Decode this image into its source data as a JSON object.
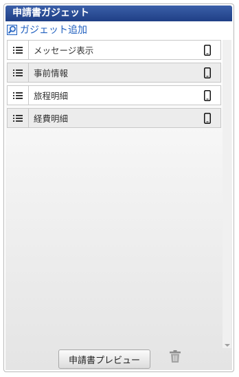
{
  "panel": {
    "title": "申請書ガジェット",
    "add_gadget_label": "ガジェット追加",
    "gadgets": [
      {
        "label": "メッセージ表示",
        "icon": "mobile-icon"
      },
      {
        "label": "事前情報",
        "icon": "mobile-icon"
      },
      {
        "label": "旅程明細",
        "icon": "mobile-icon"
      },
      {
        "label": "経費明細",
        "icon": "mobile-icon"
      }
    ],
    "preview_button_label": "申請書プレビュー"
  },
  "colors": {
    "header": "#2a4c95",
    "link": "#1f5fbf"
  }
}
